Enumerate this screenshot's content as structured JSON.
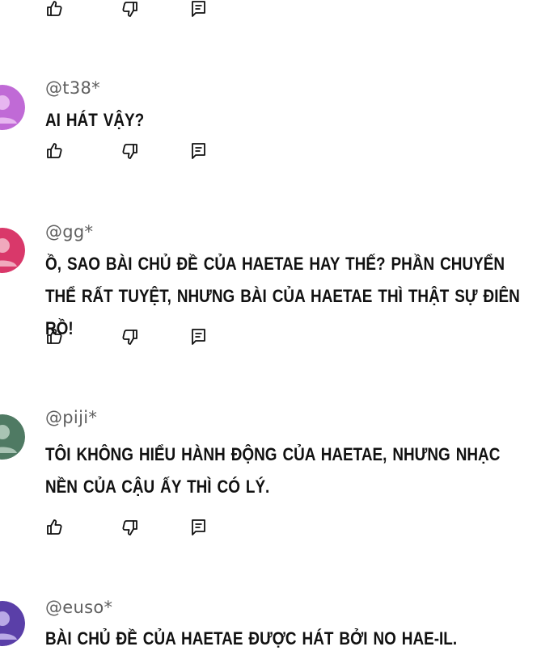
{
  "comments": [
    {
      "username": "@t38*",
      "text": "AI HÁT VẬY?",
      "avatar_color": "#c06ad6"
    },
    {
      "username": "@gg*",
      "text": "Ồ, SAO BÀI CHỦ ĐỀ CỦA HAETAE HAY THẾ? PHẦN CHUYỂN THỂ RẤT TUYỆT, NHƯNG BÀI CỦA HAETAE THÌ THẬT SỰ ĐIÊN RỒ!",
      "avatar_color": "#d9386a"
    },
    {
      "username": "@piji*",
      "text": "TÔI KHÔNG HIỂU HÀNH ĐỘNG CỦA HAETAE, NHƯNG NHẠC NỀN CỦA CẬU ẤY THÌ CÓ LÝ.",
      "avatar_color": "#4f7a63"
    },
    {
      "username": "@euso*",
      "text": "BÀI CHỦ ĐỀ CỦA HAETAE ĐƯỢC HÁT BỞI NO HAE-IL.",
      "avatar_color": "#5a3fa8"
    }
  ],
  "icons": {
    "like": "thumbs-up-icon",
    "dislike": "thumbs-down-icon",
    "reply": "reply-icon"
  }
}
